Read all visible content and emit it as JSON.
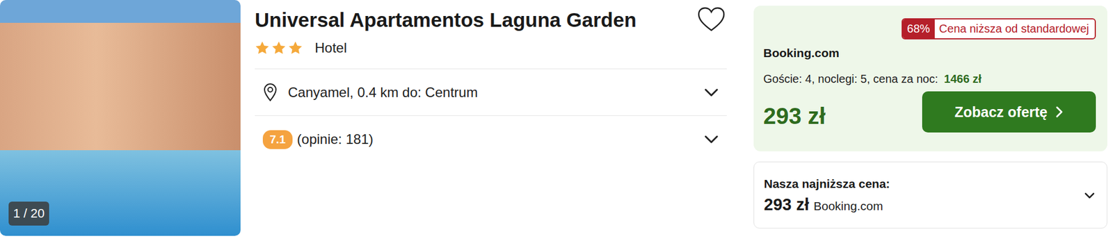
{
  "hotel": {
    "name": "Universal Apartamentos Laguna Garden",
    "stars": 3,
    "type": "Hotel",
    "favorite": false
  },
  "photo": {
    "counter": "1 / 20"
  },
  "location": {
    "text": "Canyamel, 0.4 km do: Centrum",
    "expanded": false
  },
  "rating": {
    "score": "7.1",
    "reviews": "(opinie: 181)",
    "expanded": false
  },
  "offer": {
    "discount": "68%",
    "discount_label": "Cena niższa od standardowej",
    "provider": "Booking.com",
    "details_label": "Goście: 4, noclegi: 5, cena za noc:",
    "night_price": "1466 zł",
    "price": "293 zł",
    "button": "Zobacz ofertę"
  },
  "lowest": {
    "label": "Nasza najniższa cena:",
    "price": "293 zł",
    "provider": "Booking.com",
    "expanded": false
  }
}
